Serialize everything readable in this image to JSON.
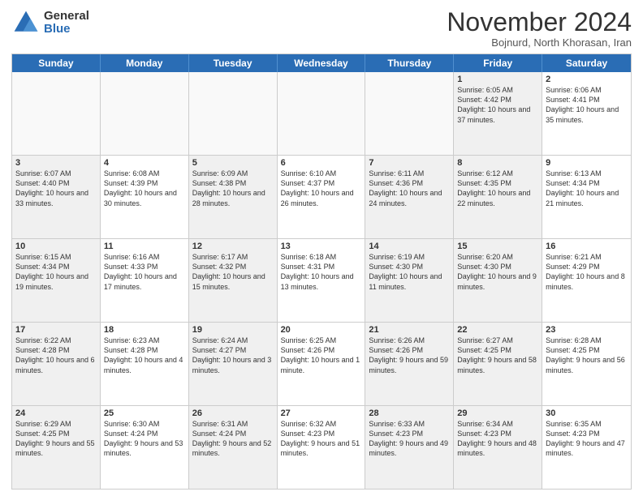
{
  "logo": {
    "general": "General",
    "blue": "Blue"
  },
  "title": "November 2024",
  "subtitle": "Bojnurd, North Khorasan, Iran",
  "weekdays": [
    "Sunday",
    "Monday",
    "Tuesday",
    "Wednesday",
    "Thursday",
    "Friday",
    "Saturday"
  ],
  "rows": [
    [
      {
        "day": "",
        "text": "",
        "empty": true
      },
      {
        "day": "",
        "text": "",
        "empty": true
      },
      {
        "day": "",
        "text": "",
        "empty": true
      },
      {
        "day": "",
        "text": "",
        "empty": true
      },
      {
        "day": "",
        "text": "",
        "empty": true
      },
      {
        "day": "1",
        "text": "Sunrise: 6:05 AM\nSunset: 4:42 PM\nDaylight: 10 hours and 37 minutes.",
        "shaded": true
      },
      {
        "day": "2",
        "text": "Sunrise: 6:06 AM\nSunset: 4:41 PM\nDaylight: 10 hours and 35 minutes."
      }
    ],
    [
      {
        "day": "3",
        "text": "Sunrise: 6:07 AM\nSunset: 4:40 PM\nDaylight: 10 hours and 33 minutes.",
        "shaded": true
      },
      {
        "day": "4",
        "text": "Sunrise: 6:08 AM\nSunset: 4:39 PM\nDaylight: 10 hours and 30 minutes."
      },
      {
        "day": "5",
        "text": "Sunrise: 6:09 AM\nSunset: 4:38 PM\nDaylight: 10 hours and 28 minutes.",
        "shaded": true
      },
      {
        "day": "6",
        "text": "Sunrise: 6:10 AM\nSunset: 4:37 PM\nDaylight: 10 hours and 26 minutes."
      },
      {
        "day": "7",
        "text": "Sunrise: 6:11 AM\nSunset: 4:36 PM\nDaylight: 10 hours and 24 minutes.",
        "shaded": true
      },
      {
        "day": "8",
        "text": "Sunrise: 6:12 AM\nSunset: 4:35 PM\nDaylight: 10 hours and 22 minutes.",
        "shaded": true
      },
      {
        "day": "9",
        "text": "Sunrise: 6:13 AM\nSunset: 4:34 PM\nDaylight: 10 hours and 21 minutes."
      }
    ],
    [
      {
        "day": "10",
        "text": "Sunrise: 6:15 AM\nSunset: 4:34 PM\nDaylight: 10 hours and 19 minutes.",
        "shaded": true
      },
      {
        "day": "11",
        "text": "Sunrise: 6:16 AM\nSunset: 4:33 PM\nDaylight: 10 hours and 17 minutes."
      },
      {
        "day": "12",
        "text": "Sunrise: 6:17 AM\nSunset: 4:32 PM\nDaylight: 10 hours and 15 minutes.",
        "shaded": true
      },
      {
        "day": "13",
        "text": "Sunrise: 6:18 AM\nSunset: 4:31 PM\nDaylight: 10 hours and 13 minutes."
      },
      {
        "day": "14",
        "text": "Sunrise: 6:19 AM\nSunset: 4:30 PM\nDaylight: 10 hours and 11 minutes.",
        "shaded": true
      },
      {
        "day": "15",
        "text": "Sunrise: 6:20 AM\nSunset: 4:30 PM\nDaylight: 10 hours and 9 minutes.",
        "shaded": true
      },
      {
        "day": "16",
        "text": "Sunrise: 6:21 AM\nSunset: 4:29 PM\nDaylight: 10 hours and 8 minutes."
      }
    ],
    [
      {
        "day": "17",
        "text": "Sunrise: 6:22 AM\nSunset: 4:28 PM\nDaylight: 10 hours and 6 minutes.",
        "shaded": true
      },
      {
        "day": "18",
        "text": "Sunrise: 6:23 AM\nSunset: 4:28 PM\nDaylight: 10 hours and 4 minutes."
      },
      {
        "day": "19",
        "text": "Sunrise: 6:24 AM\nSunset: 4:27 PM\nDaylight: 10 hours and 3 minutes.",
        "shaded": true
      },
      {
        "day": "20",
        "text": "Sunrise: 6:25 AM\nSunset: 4:26 PM\nDaylight: 10 hours and 1 minute."
      },
      {
        "day": "21",
        "text": "Sunrise: 6:26 AM\nSunset: 4:26 PM\nDaylight: 9 hours and 59 minutes.",
        "shaded": true
      },
      {
        "day": "22",
        "text": "Sunrise: 6:27 AM\nSunset: 4:25 PM\nDaylight: 9 hours and 58 minutes.",
        "shaded": true
      },
      {
        "day": "23",
        "text": "Sunrise: 6:28 AM\nSunset: 4:25 PM\nDaylight: 9 hours and 56 minutes."
      }
    ],
    [
      {
        "day": "24",
        "text": "Sunrise: 6:29 AM\nSunset: 4:25 PM\nDaylight: 9 hours and 55 minutes.",
        "shaded": true
      },
      {
        "day": "25",
        "text": "Sunrise: 6:30 AM\nSunset: 4:24 PM\nDaylight: 9 hours and 53 minutes."
      },
      {
        "day": "26",
        "text": "Sunrise: 6:31 AM\nSunset: 4:24 PM\nDaylight: 9 hours and 52 minutes.",
        "shaded": true
      },
      {
        "day": "27",
        "text": "Sunrise: 6:32 AM\nSunset: 4:23 PM\nDaylight: 9 hours and 51 minutes."
      },
      {
        "day": "28",
        "text": "Sunrise: 6:33 AM\nSunset: 4:23 PM\nDaylight: 9 hours and 49 minutes.",
        "shaded": true
      },
      {
        "day": "29",
        "text": "Sunrise: 6:34 AM\nSunset: 4:23 PM\nDaylight: 9 hours and 48 minutes.",
        "shaded": true
      },
      {
        "day": "30",
        "text": "Sunrise: 6:35 AM\nSunset: 4:23 PM\nDaylight: 9 hours and 47 minutes."
      }
    ]
  ]
}
